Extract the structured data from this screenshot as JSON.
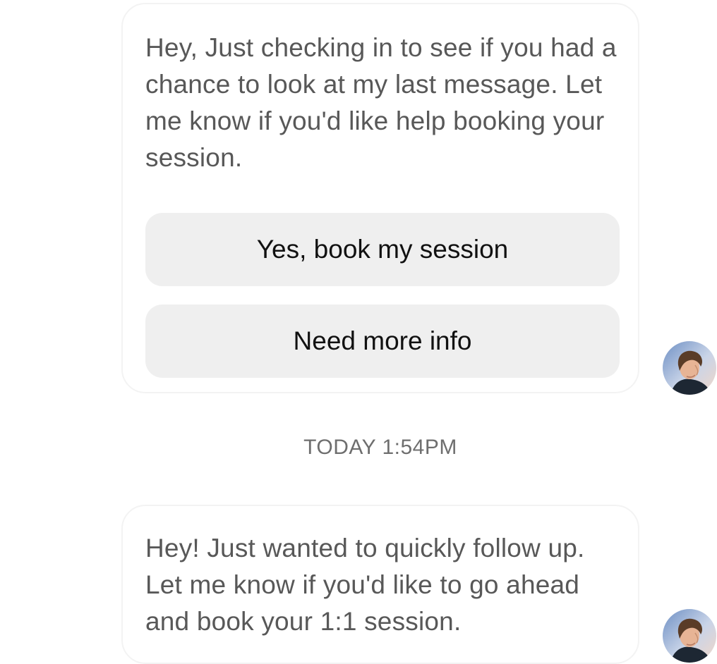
{
  "messages": [
    {
      "text": "Hey, Just checking in to see if you had a chance to look at my last message. Let me know if you'd like help booking your session.",
      "actions": [
        {
          "label": "Yes, book my session"
        },
        {
          "label": "Need more info"
        }
      ]
    },
    {
      "timestamp": "TODAY 1:54PM",
      "text": "Hey! Just wanted to quickly follow up. Let me know if you'd like to go ahead and book your 1:1 session."
    }
  ],
  "colors": {
    "message_text": "#585858",
    "button_bg": "#efefef",
    "button_text": "#111111",
    "timestamp_text": "#6e6e6e"
  },
  "icons": {
    "avatar": "user-avatar-photo"
  }
}
